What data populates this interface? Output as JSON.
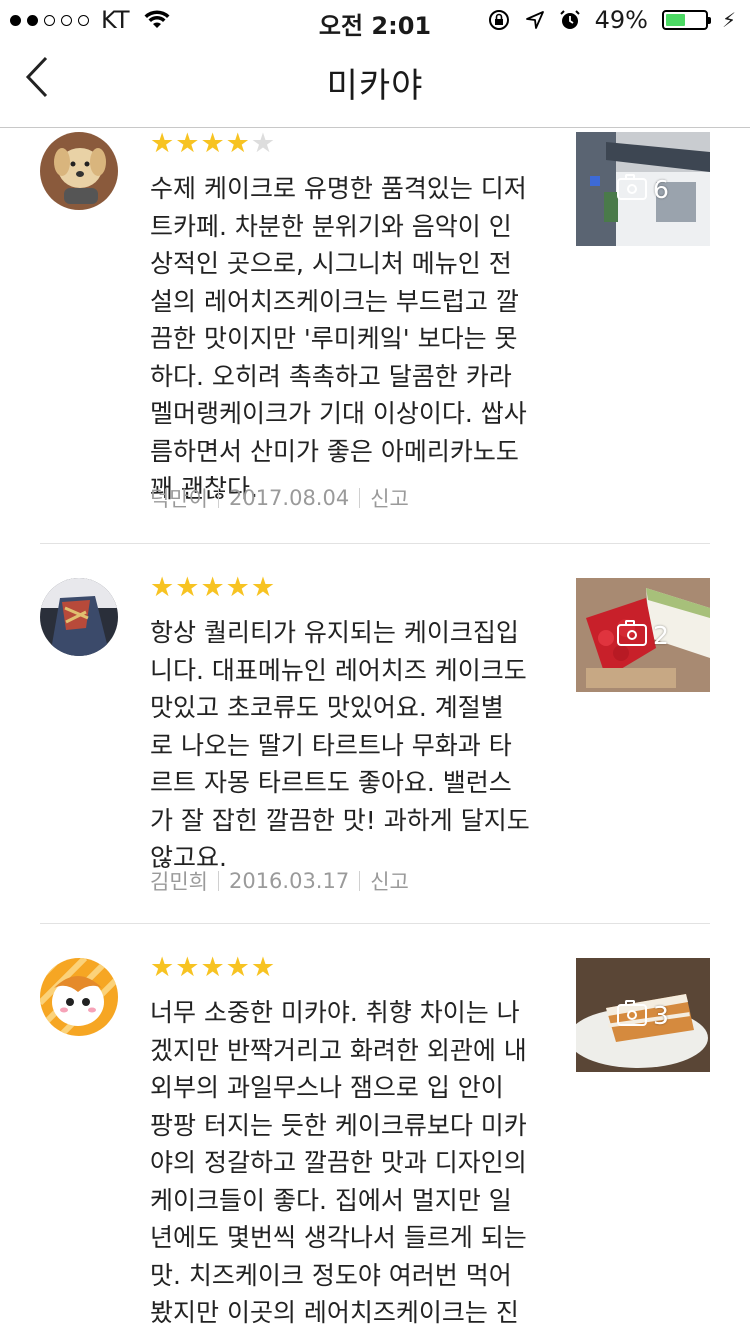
{
  "status_bar": {
    "carrier": "KT",
    "time": "오전 2:01",
    "battery": "49%",
    "battery_level": 0.49
  },
  "nav": {
    "title": "미카야",
    "back_icon": "chevron-left-icon"
  },
  "colors": {
    "star_on": "#f7c322",
    "star_off": "#dddddd",
    "meta_text": "#9a9a9a"
  },
  "reviews": [
    {
      "rating": 4,
      "text": "수제 케이크로 유명한 품격있는 디저\n트카페. 차분한 분위기와 음악이 인\n상적인 곳으로, 시그니처 메뉴인 전\n설의 레어치즈케이크는 부드럽고 깔\n끔한 맛이지만 '루미케잌' 보다는 못\n하다. 오히려 촉촉하고 달콤한 카라\n멜머랭케이크가 기대 이상이다. 쌉사\n름하면서 산미가 좋은 아메리카노도\n꽤 괜찮다.",
      "author": "덕만이",
      "date": "2017.08.04",
      "report": "신고",
      "photo_count": "6"
    },
    {
      "rating": 5,
      "text": "항상 퀄리티가 유지되는 케이크집입\n니다. 대표메뉴인 레어치즈 케이크도\n 맛있고 초코류도 맛있어요. 계절별\n로 나오는 딸기 타르트나 무화과 타\n르트 자몽 타르트도 좋아요. 밸런스\n가 잘 잡힌 깔끔한 맛! 과하게 달지도\n 않고요.",
      "author": "김민희",
      "date": "2016.03.17",
      "report": "신고",
      "photo_count": "2"
    },
    {
      "rating": 5,
      "text": "너무 소중한 미카야. 취향 차이는 나\n겠지만 반짝거리고 화려한 외관에 내\n외부의 과일무스나 잼으로 입 안이\n팡팡 터지는 듯한 케이크류보다 미카\n야의 정갈하고 깔끔한 맛과 디자인의\n 케이크들이 좋다. 집에서 멀지만 일\n년에도 몇번씩 생각나서 들르게 되는\n 맛.  치즈케이크 정도야 여러번 먹어\n봤지만 이곳의 레어치즈케이크는 진\n짜 엄청난 인상을 주었다. 그 외에 당",
      "photo_count": "3"
    }
  ]
}
